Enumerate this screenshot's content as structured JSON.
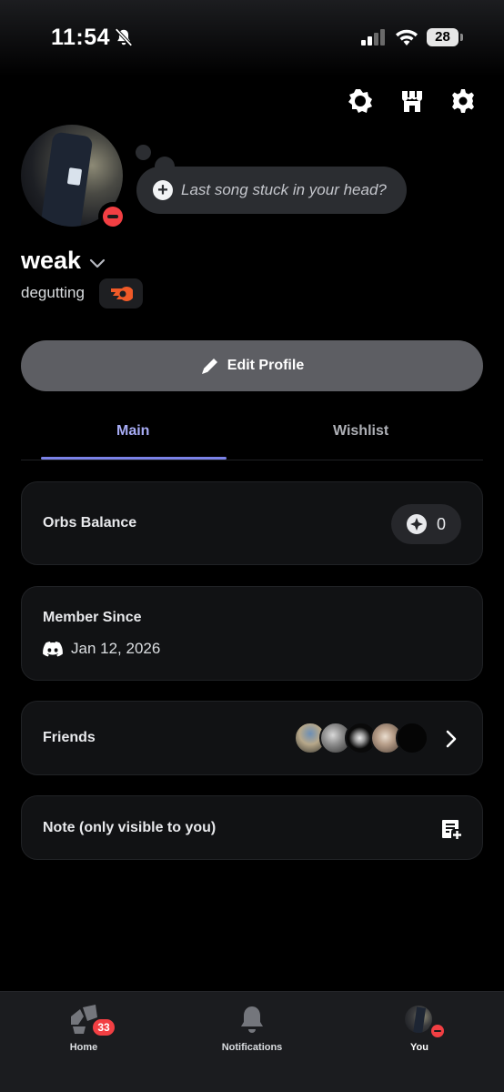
{
  "status_bar": {
    "time": "11:54",
    "battery": "28"
  },
  "profile": {
    "status_prompt": "Last song stuck in your head?",
    "display_name": "weak",
    "username": "degutting",
    "edit_label": "Edit Profile"
  },
  "tabs": [
    {
      "label": "Main",
      "active": true
    },
    {
      "label": "Wishlist",
      "active": false
    }
  ],
  "cards": {
    "orbs": {
      "title": "Orbs Balance",
      "value": "0"
    },
    "member": {
      "title": "Member Since",
      "date": "Jan 12, 2026"
    },
    "friends": {
      "title": "Friends"
    },
    "note": {
      "title": "Note (only visible to you)"
    }
  },
  "bottom_nav": {
    "home": {
      "label": "Home",
      "badge": "33"
    },
    "notifications": {
      "label": "Notifications"
    },
    "you": {
      "label": "You"
    }
  },
  "colors": {
    "accent": "#a7acf5",
    "dnd": "#f23f43",
    "badge_orange": "#f05a28"
  }
}
